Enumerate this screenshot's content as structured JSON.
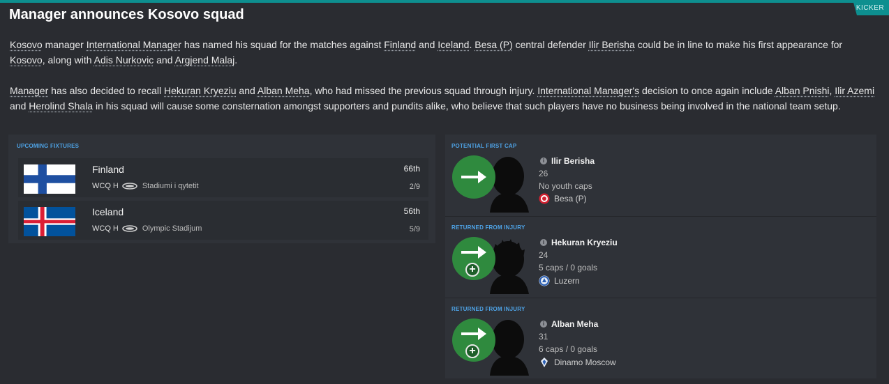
{
  "header": {
    "title": "Manager announces Kosovo squad",
    "tag": "KICKER"
  },
  "article": {
    "p1": {
      "t1": "Kosovo",
      "t2": " manager ",
      "t3": "International Manager",
      "t4": " has named his squad for the matches against ",
      "t5": "Finland",
      "t6": " and ",
      "t7": "Iceland",
      "t8": ". ",
      "t9": "Besa (P)",
      "t10": " central defender ",
      "t11": "Ilir Berisha",
      "t12": " could be in line to make his first appearance for ",
      "t13": "Kosovo",
      "t14": ", along with ",
      "t15": "Adis Nurkovic",
      "t16": " and ",
      "t17": "Argjend Malaj",
      "t18": "."
    },
    "p2": {
      "t1": "Manager",
      "t2": " has also decided to recall ",
      "t3": "Hekuran Kryeziu",
      "t4": " and ",
      "t5": "Alban Meha",
      "t6": ", who had missed the previous squad through injury. ",
      "t7": "International Manager's",
      "t8": " decision to once again include ",
      "t9": "Alban Pnishi",
      "t10": ", ",
      "t11": "Ilir Azemi",
      "t12": " and ",
      "t13": "Herolind Shala",
      "t14": " in his squad will cause some consternation amongst supporters and pundits alike, who believe that such players have no business being involved in the national team setup."
    }
  },
  "fixtures": {
    "label": "UPCOMING FIXTURES",
    "items": [
      {
        "team": "Finland",
        "rank": "66th",
        "comp": "WCQ",
        "venue_type": "H",
        "stadium": "Stadiumi i qytetit",
        "date": "2/9"
      },
      {
        "team": "Iceland",
        "rank": "56th",
        "comp": "WCQ",
        "venue_type": "H",
        "stadium": "Olympic Stadijum",
        "date": "5/9"
      }
    ]
  },
  "players": [
    {
      "label": "POTENTIAL FIRST CAP",
      "name": "Ilir Berisha",
      "age": "26",
      "caps": "No youth caps",
      "club": "Besa (P)"
    },
    {
      "label": "RETURNED FROM INJURY",
      "name": "Hekuran Kryeziu",
      "age": "24",
      "caps": "5 caps / 0 goals",
      "club": "Luzern"
    },
    {
      "label": "RETURNED FROM INJURY",
      "name": "Alban Meha",
      "age": "31",
      "caps": "6 caps / 0 goals",
      "club": "Dinamo Moscow"
    }
  ],
  "colors": {
    "accent": "#0d8f8f",
    "label_blue": "#4ea3e6",
    "circle_green": "#2f8a3e",
    "background": "#2a2c31"
  },
  "icons": [
    "arrow-right-icon",
    "plus-icon",
    "info-icon",
    "stadium-icon",
    "club-badge-icon"
  ]
}
